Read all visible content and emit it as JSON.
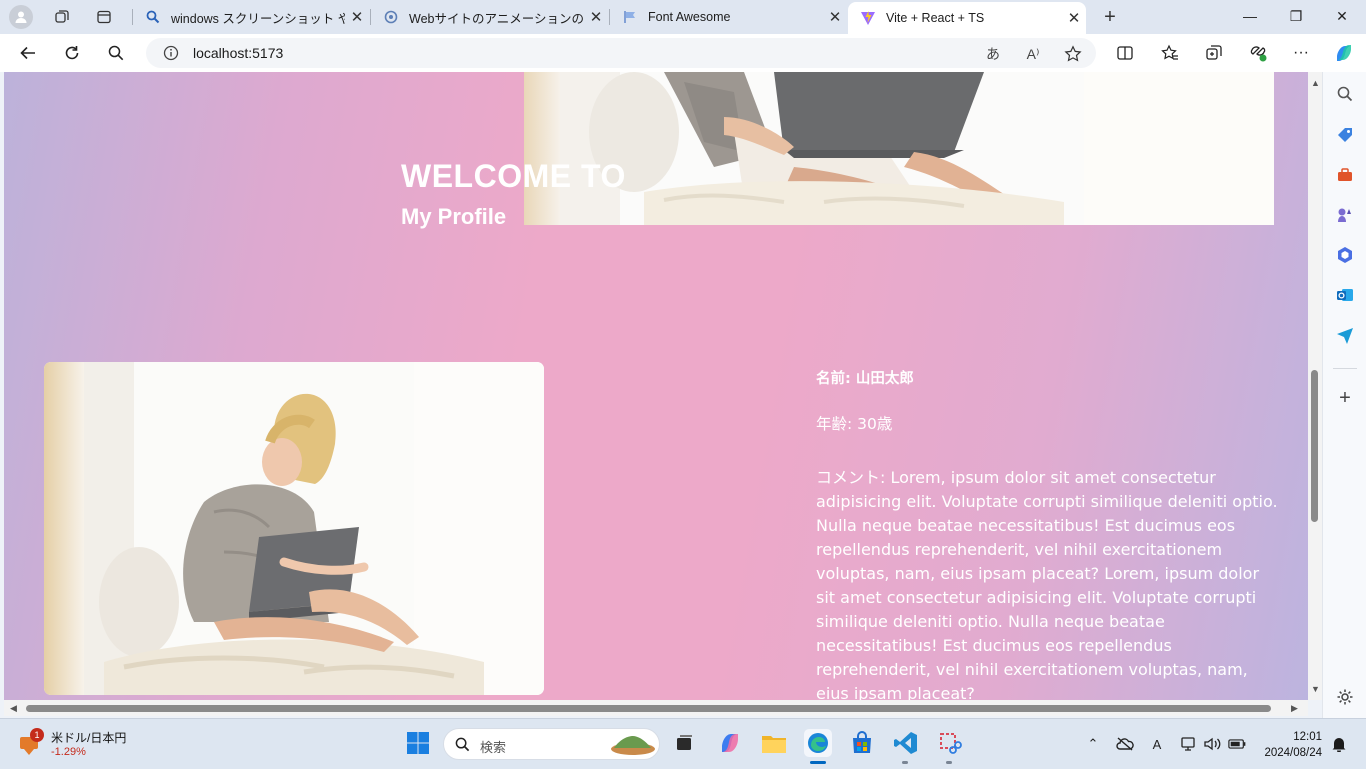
{
  "browser": {
    "tabs": [
      {
        "title": "windows スクリーンショット やり方 - 検索",
        "icon": "search-icon"
      },
      {
        "title": "Webサイトのアニメーションの種類と効果",
        "icon": "globe-icon"
      },
      {
        "title": "Font Awesome",
        "icon": "flag-icon"
      },
      {
        "title": "Vite + React + TS",
        "icon": "vite-icon",
        "active": true
      }
    ],
    "url": "localhost:5173"
  },
  "page": {
    "hero_title": "WELCOME TO",
    "hero_subtitle": "My Profile",
    "name_line": "名前: 山田太郎",
    "age_line": "年齢: 30歳",
    "comment": "コメント: Lorem, ipsum dolor sit amet consectetur adipisicing elit. Voluptate corrupti similique deleniti optio. Nulla neque beatae necessitatibus! Est ducimus eos repellendus reprehenderit, vel nihil exercitationem voluptas, nam, eius ipsam placeat? Lorem, ipsum dolor sit amet consectetur adipisicing elit. Voluptate corrupti similique deleniti optio. Nulla neque beatae necessitatibus! Est ducimus eos repellendus reprehenderit, vel nihil exercitationem voluptas, nam, eius ipsam placeat?"
  },
  "taskbar": {
    "widget_title": "米ドル/日本円",
    "widget_change": "-1.29%",
    "widget_badge": "1",
    "search_placeholder": "検索",
    "time": "12:01",
    "date": "2024/08/24"
  },
  "colors": {
    "page_gradient": [
      "#bcb2da",
      "#eda9c9",
      "#bcb4df"
    ],
    "accent": "#0067c0"
  }
}
